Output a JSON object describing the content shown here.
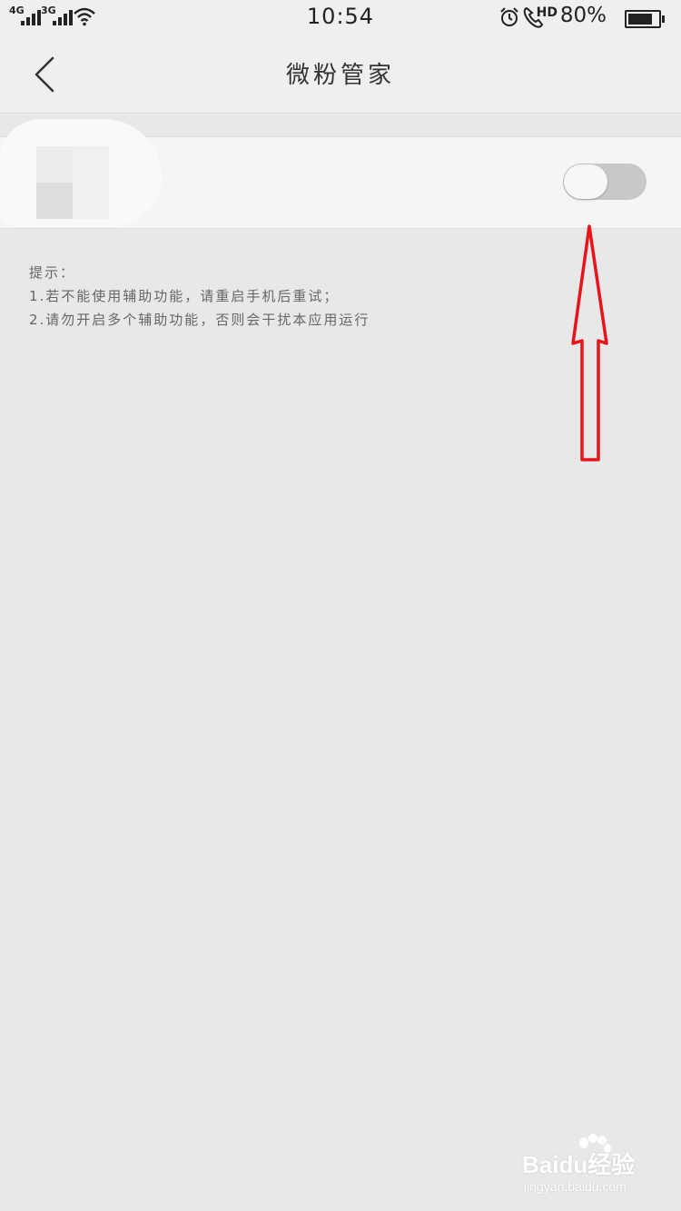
{
  "status_bar": {
    "network1": "4G",
    "network2": "3G",
    "time": "10:54",
    "hd_label": "HD",
    "battery_percent": "80%",
    "battery_level": 0.8,
    "icons": [
      "signal-icon",
      "wifi-icon",
      "alarm-icon",
      "phone-icon",
      "battery-icon"
    ]
  },
  "header": {
    "title": "微粉管家",
    "back_icon": "chevron-left-icon"
  },
  "service_row": {
    "toggle_on": false
  },
  "tips": {
    "heading": "提示：",
    "line1": "1.若不能使用辅助功能，请重启手机后重试；",
    "line2": "2.请勿开启多个辅助功能，否则会干扰本应用运行"
  },
  "annotation": {
    "arrow_color": "#e8141c"
  },
  "watermark": {
    "brand": "Baidu经验",
    "url": "jingyan.baidu.com"
  }
}
